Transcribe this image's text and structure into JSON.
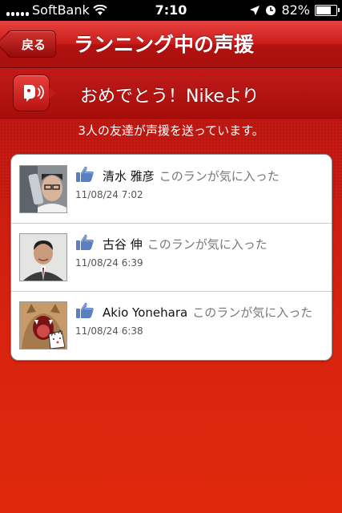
{
  "status_bar": {
    "carrier": "SoftBank",
    "time": "7:10",
    "battery_percent": "82%",
    "battery_level": 0.82
  },
  "navbar": {
    "back_label": "戻る",
    "title": "ランニング中の声援"
  },
  "banner": {
    "text": "おめでとう！Nikeより",
    "icon": "cheer-speaker-icon"
  },
  "summary": "3人の友達が声援を送っています。",
  "cheers": [
    {
      "name": "清水 雅彦",
      "message": "このランが気に入った",
      "date": "11/08/24  7:02",
      "icon": "thumbs-up-icon"
    },
    {
      "name": "古谷 伸",
      "message": "このランが気に入った",
      "date": "11/08/24  6:39",
      "icon": "thumbs-up-icon"
    },
    {
      "name": "Akio Yonehara",
      "message": "このランが気に入った",
      "date": "11/08/24  6:38",
      "icon": "thumbs-up-icon"
    }
  ],
  "colors": {
    "brand_red": "#c81c1a",
    "like_blue": "#5a7fc0"
  }
}
